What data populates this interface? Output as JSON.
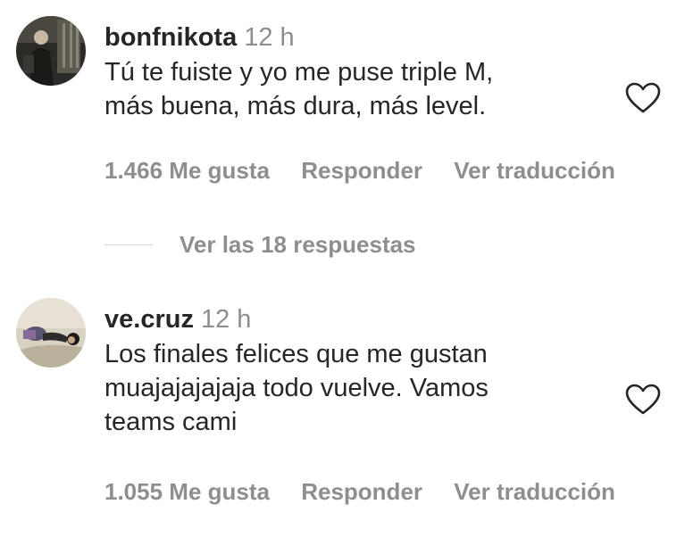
{
  "comments": [
    {
      "username": "bonfnikota",
      "time": "12 h",
      "text_lines": [
        "Tú te fuiste y yo me puse triple M,",
        "más buena, más dura, más level."
      ],
      "likes": "1.466 Me gusta",
      "reply": "Responder",
      "translate": "Ver traducción",
      "avatar_icon": "user-avatar-photo",
      "like_icon": "heart-outline-icon"
    },
    {
      "username": "ve.cruz",
      "time": "12 h",
      "text_lines": [
        "Los finales felices que me gustan",
        "muajajajajaja todo vuelve. Vamos",
        "teams cami"
      ],
      "likes": "1.055 Me gusta",
      "reply": "Responder",
      "translate": "Ver traducción",
      "avatar_icon": "user-avatar-photo",
      "like_icon": "heart-outline-icon"
    }
  ],
  "replies": {
    "label": "Ver las 18 respuestas"
  },
  "colors": {
    "primary_text": "#262626",
    "secondary_text": "#8e8e8e",
    "divider": "#dbdbdb"
  }
}
